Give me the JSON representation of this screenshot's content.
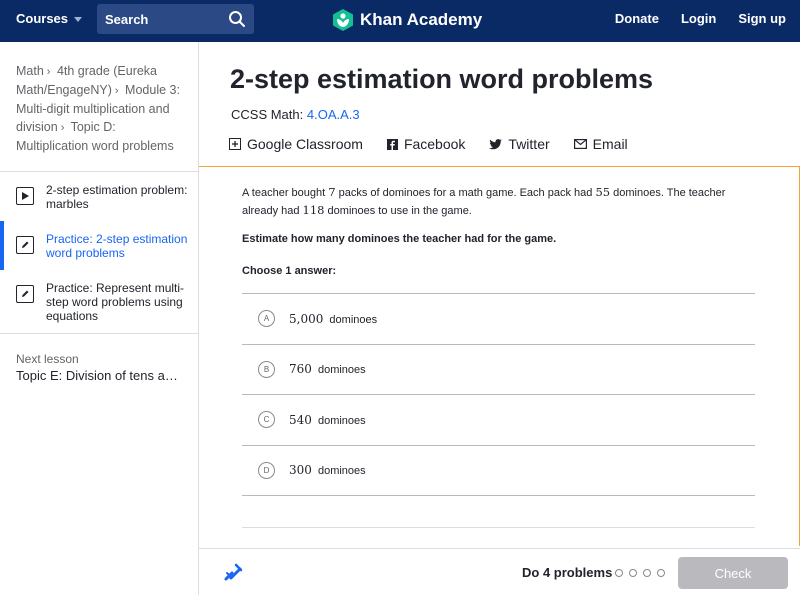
{
  "header": {
    "courses_label": "Courses",
    "search_label": "Search",
    "brand": "Khan Academy",
    "nav": [
      "Donate",
      "Login",
      "Sign up"
    ]
  },
  "sidebar": {
    "breadcrumbs": [
      "Math",
      "4th grade (Eureka Math/EngageNY)",
      "Module 3: Multi-digit multiplication and division",
      "Topic D: Multiplication word problems"
    ],
    "items": [
      {
        "label": "2-step estimation problem: marbles",
        "icon": "play-icon",
        "active": false
      },
      {
        "label": "Practice: 2-step estimation word problems",
        "icon": "pencil-icon",
        "active": true
      },
      {
        "label": "Practice: Represent multi-step word problems using equations",
        "icon": "pencil-icon",
        "active": false
      }
    ],
    "next_lesson_label": "Next lesson",
    "next_lesson_value": "Topic E: Division of tens and ones with successive remainders"
  },
  "main": {
    "title": "2-step estimation word problems",
    "ccss_label": "CCSS Math:",
    "ccss_code": "4.OA.A.3",
    "share": [
      "Google Classroom",
      "Facebook",
      "Twitter",
      "Email"
    ]
  },
  "exercise": {
    "q_part1": "A teacher bought ",
    "q_num1": "7",
    "q_part2": " packs of dominoes for a math game. Each pack had ",
    "q_num2": "55",
    "q_part3": " dominoes. The teacher already had ",
    "q_num3": "118",
    "q_part4": " dominoes to use in the game.",
    "prompt": "Estimate how many dominoes the teacher had for the game.",
    "choose_label": "Choose 1 answer:",
    "choices": [
      {
        "letter": "A",
        "value": "5,000",
        "unit": "dominoes"
      },
      {
        "letter": "B",
        "value": "760",
        "unit": "dominoes"
      },
      {
        "letter": "C",
        "value": "540",
        "unit": "dominoes"
      },
      {
        "letter": "D",
        "value": "300",
        "unit": "dominoes"
      }
    ]
  },
  "footer": {
    "do_label": "Do 4 problems",
    "check_label": "Check"
  },
  "colors": {
    "header_bg": "#0a2a66",
    "accent": "#1865f2",
    "panel_border": "#f0a33a",
    "logo_green": "#14bf96"
  }
}
